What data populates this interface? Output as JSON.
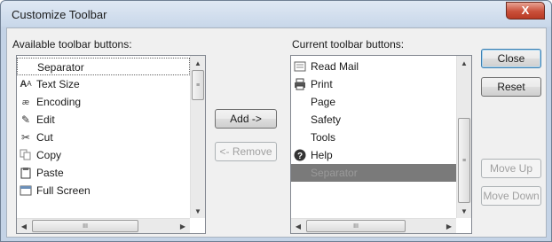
{
  "window": {
    "title": "Customize Toolbar"
  },
  "available": {
    "label": "Available toolbar buttons:",
    "items": [
      {
        "label": "Separator",
        "icon": ""
      },
      {
        "label": "Text Size",
        "icon": "text-size-icon"
      },
      {
        "label": "Encoding",
        "icon": "encoding-icon"
      },
      {
        "label": "Edit",
        "icon": "edit-pencil-icon"
      },
      {
        "label": "Cut",
        "icon": "scissors-icon"
      },
      {
        "label": "Copy",
        "icon": "copy-icon"
      },
      {
        "label": "Paste",
        "icon": "paste-icon"
      },
      {
        "label": "Full Screen",
        "icon": "full-screen-icon"
      }
    ]
  },
  "current": {
    "label": "Current toolbar buttons:",
    "items": [
      {
        "label": "Read Mail",
        "icon": "read-mail-icon"
      },
      {
        "label": "Print",
        "icon": "printer-icon"
      },
      {
        "label": "Page",
        "icon": ""
      },
      {
        "label": "Safety",
        "icon": ""
      },
      {
        "label": "Tools",
        "icon": ""
      },
      {
        "label": "Help",
        "icon": "help-icon"
      },
      {
        "label": "Separator",
        "icon": ""
      }
    ],
    "selected_index": 6
  },
  "buttons": {
    "add": "Add ->",
    "remove": "<- Remove",
    "close": "Close",
    "reset": "Reset",
    "move_up": "Move Up",
    "move_down": "Move Down"
  },
  "scroll_glyph": "III",
  "close_glyph": "X"
}
